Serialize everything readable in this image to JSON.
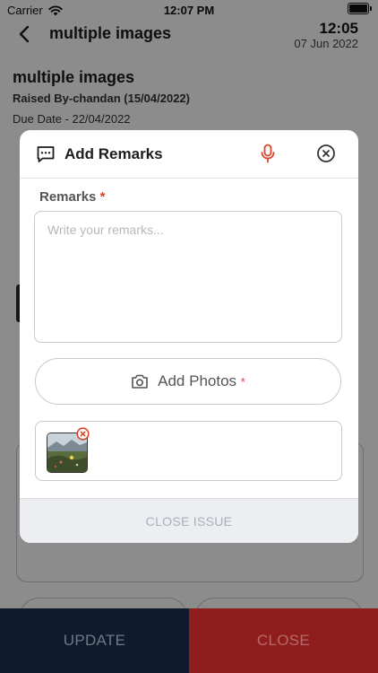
{
  "status_bar": {
    "carrier": "Carrier",
    "time": "12:07 PM"
  },
  "header": {
    "title": "multiple images",
    "time": "12:05",
    "date": "07 Jun 2022"
  },
  "issue": {
    "title": "multiple images",
    "raised_by": "Raised By-chandan (15/04/2022)",
    "due_date": "Due Date - 22/04/2022"
  },
  "modal": {
    "title": "Add Remarks",
    "remarks_label": "Remarks",
    "required_mark": "*",
    "remarks_placeholder": "Write your remarks...",
    "add_photos_label": "Add Photos",
    "close_issue_label": "CLOSE ISSUE"
  },
  "bottom_bar": {
    "update_label": "UPDATE",
    "close_label": "CLOSE"
  },
  "colors": {
    "accent_red": "#d9452b",
    "bottom_update_bg": "#0f1b2c",
    "bottom_close_bg": "#8f1d1d"
  }
}
